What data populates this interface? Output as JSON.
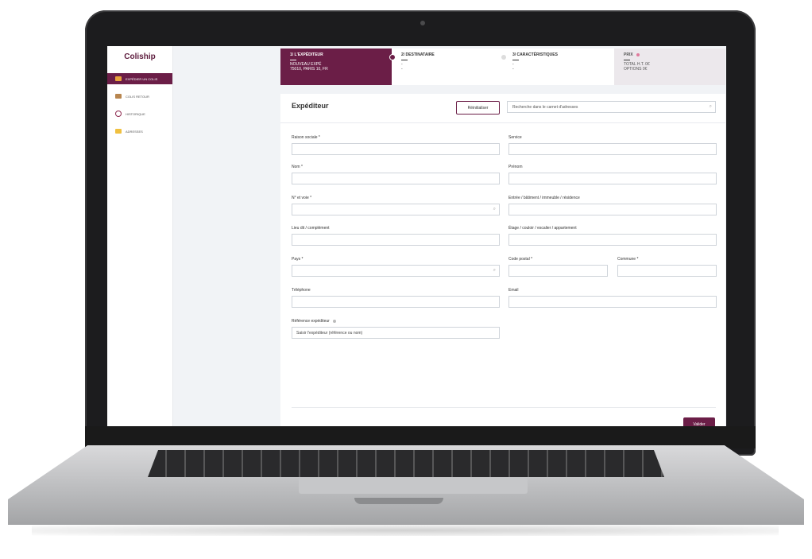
{
  "app": {
    "brand": "Coliship"
  },
  "sidebar": {
    "items": [
      {
        "label": "EXPÉDIER UN COLIS",
        "icon": "package-icon",
        "active": true
      },
      {
        "label": "COLIS RETOUR",
        "icon": "return-box-icon",
        "active": false
      },
      {
        "label": "HISTORIQUE",
        "icon": "history-icon",
        "active": false
      },
      {
        "label": "ADRESSES",
        "icon": "address-book-icon",
        "active": false
      }
    ]
  },
  "steps": [
    {
      "title": "1/ L'EXPÉDITEUR",
      "lines": [
        "NOUVEAU EXPÉ",
        "75010, PARIS 10, FR"
      ]
    },
    {
      "title": "2/ DESTINATAIRE",
      "lines": [
        "-",
        "-"
      ]
    },
    {
      "title": "3/ CARACTÉRISTIQUES",
      "lines": [
        "-",
        "-"
      ]
    },
    {
      "title": "PRIX",
      "lines": [
        "TOTAL H.T.  0€",
        "OPTIONS  0€"
      ]
    }
  ],
  "form": {
    "title": "Expéditeur",
    "reset_label": "Réinitialiser",
    "search_placeholder": "Recherche dans le carnet d'adresses",
    "labels": {
      "raison_sociale": "Raison sociale *",
      "service": "Service",
      "nom": "Nom *",
      "prenom": "Prénom",
      "voie": "N° et voie *",
      "entree": "Entrée / bâtiment / immeuble / résidence",
      "lieu_dit": "Lieu dit / complément",
      "etage": "Étage / couloir / escalier / appartement",
      "pays": "Pays *",
      "code_postal": "Code postal *",
      "commune": "Commune *",
      "telephone": "Téléphone",
      "email": "Email",
      "reference": "Référence expéditeur"
    },
    "reference_value": "Saisir l'expéditeur (référence ou nom)",
    "validate_label": "Valider"
  },
  "colors": {
    "accent": "#6b1e47",
    "price_bg": "#ece8ec"
  }
}
